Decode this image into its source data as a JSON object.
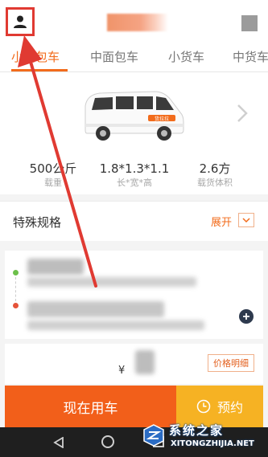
{
  "header": {
    "user_icon": "person-icon"
  },
  "tabs": [
    {
      "label": "小面包车",
      "active": true
    },
    {
      "label": "中面包车",
      "active": false
    },
    {
      "label": "小货车",
      "active": false
    },
    {
      "label": "中货车",
      "active": false
    }
  ],
  "vehicle": {
    "badge": "货拉拉",
    "specs": [
      {
        "value": "500公斤",
        "label": "载重"
      },
      {
        "value": "1.8*1.3*1.1",
        "label": "长*宽*高"
      },
      {
        "value": "2.6方",
        "label": "载货体积"
      }
    ]
  },
  "special": {
    "title": "特殊规格",
    "expand_label": "展开"
  },
  "price": {
    "currency": "¥",
    "detail_label": "价格明细"
  },
  "actions": {
    "use_now": "现在用车",
    "reserve": "预约"
  },
  "watermark": {
    "text": "系统之家",
    "url": "XITONGZHIJIA.NET"
  },
  "colors": {
    "accent": "#f26c1c",
    "use_now_bg": "#f25f1a",
    "reserve_bg": "#f6b223",
    "annotation": "#e03a32"
  }
}
